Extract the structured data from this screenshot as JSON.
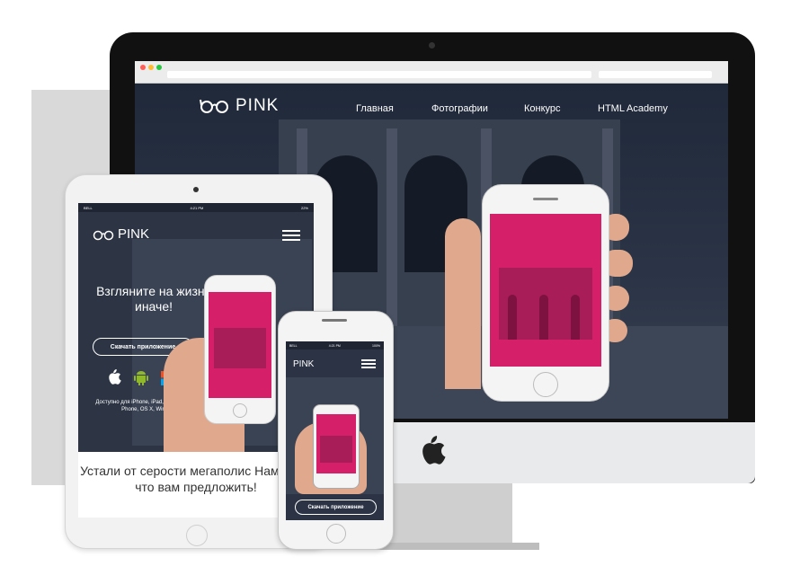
{
  "colors": {
    "accent": "#d51f69",
    "site_bg": "#2b3547",
    "device_silver": "#f2f2f2"
  },
  "desktop": {
    "logo_text": "PINK",
    "nav": [
      "Главная",
      "Фотографии",
      "Конкурс",
      "HTML Academy"
    ],
    "icons": {
      "logo": "glasses-icon",
      "brand": "apple-icon"
    }
  },
  "tablet": {
    "status": {
      "carrier": "BELL",
      "time": "4:21 PM",
      "battery": "22%"
    },
    "logo_text": "PINK",
    "heading": "Взгляните на жизнь иначе!",
    "download_button": "Скачать приложение",
    "platforms": [
      "apple-icon",
      "android-icon",
      "windows-icon"
    ],
    "availability": "Доступно для iPhone, iPad, Android, Windows Phone, OS X, Windows 8",
    "bottom_text": "Устали от серости мегаполис Нам есть, что вам предложить!"
  },
  "phone": {
    "status": {
      "carrier": "BELL",
      "time": "4:21 PM",
      "battery": "100%"
    },
    "logo_text": "PINK",
    "download_button": "Скачать приложение"
  }
}
